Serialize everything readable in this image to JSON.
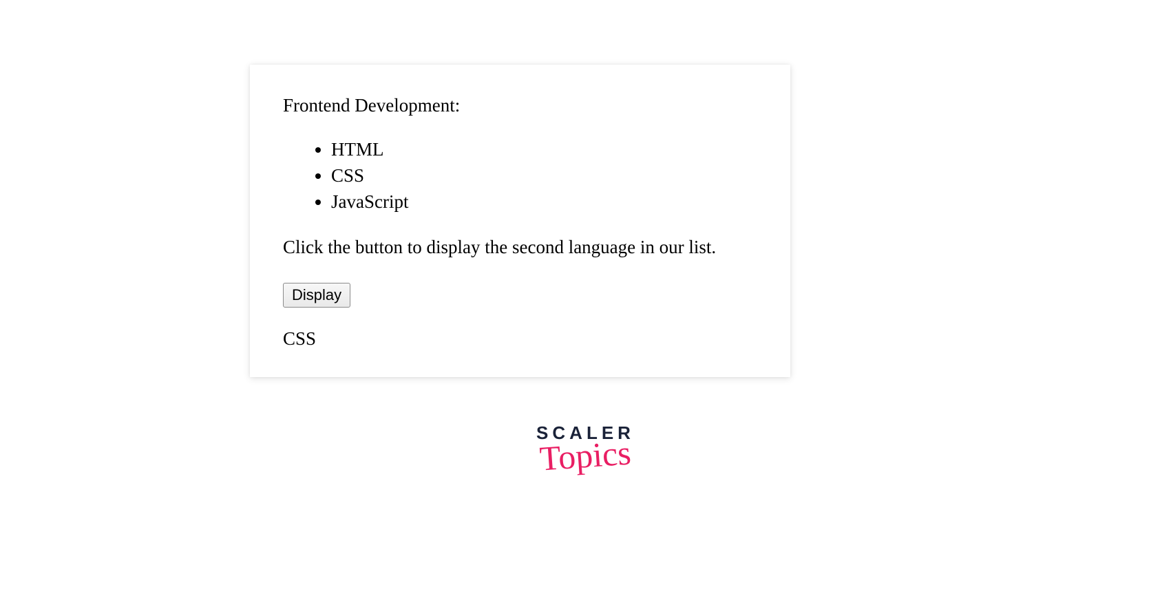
{
  "card": {
    "heading": "Frontend Development:",
    "list": {
      "item0": "HTML",
      "item1": "CSS",
      "item2": "JavaScript"
    },
    "instruction": "Click the button to display the second language in our list.",
    "button_label": "Display",
    "output": "CSS"
  },
  "brand": {
    "line1": "SCALER",
    "line2": "Topics"
  }
}
